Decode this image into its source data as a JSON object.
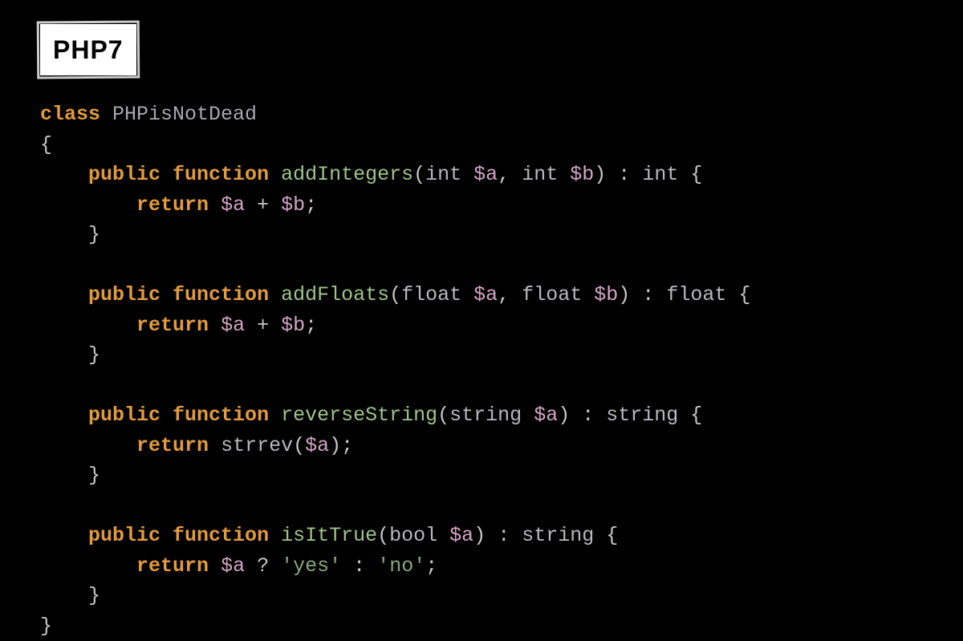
{
  "badge": "PHP7",
  "code": {
    "kw_class": "class",
    "classname": "PHPisNotDead",
    "kw_public": "public",
    "kw_function": "function",
    "kw_return": "return",
    "fn1": {
      "name": "addIntegers",
      "p1_type": "int",
      "p1_var": "$a",
      "p2_type": "int",
      "p2_var": "$b",
      "ret_type": "int",
      "body_a": "$a",
      "body_op": "+",
      "body_b": "$b"
    },
    "fn2": {
      "name": "addFloats",
      "p1_type": "float",
      "p1_var": "$a",
      "p2_type": "float",
      "p2_var": "$b",
      "ret_type": "float",
      "body_a": "$a",
      "body_op": "+",
      "body_b": "$b"
    },
    "fn3": {
      "name": "reverseString",
      "p1_type": "string",
      "p1_var": "$a",
      "ret_type": "string",
      "call": "strrev",
      "arg": "$a"
    },
    "fn4": {
      "name": "isItTrue",
      "p1_type": "bool",
      "p1_var": "$a",
      "ret_type": "string",
      "cond_var": "$a",
      "q": "?",
      "yes": "'yes'",
      "colon": ":",
      "no": "'no'"
    }
  }
}
